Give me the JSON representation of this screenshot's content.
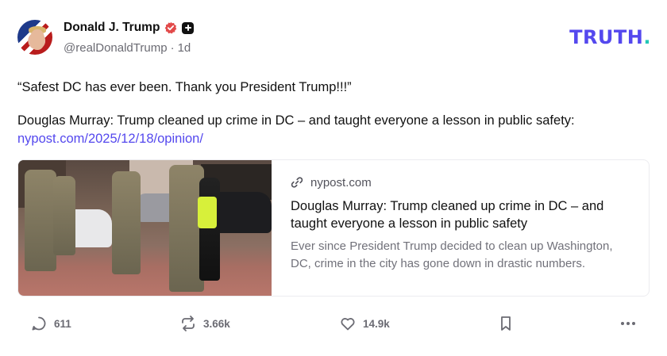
{
  "author": {
    "display_name": "Donald J. Trump",
    "handle": "@realDonaldTrump",
    "separator": "·",
    "time_ago": "1d"
  },
  "brand": {
    "logo_text": "TRUTH",
    "logo_dot": "."
  },
  "post": {
    "quote": "“Safest DC has ever been. Thank you President Trump!!!”",
    "body": "Douglas Murray: Trump cleaned up crime in DC – and taught everyone a lesson in public safety:",
    "link_text": "nypost.com/2025/12/18/opinion/"
  },
  "link_card": {
    "domain": "nypost.com",
    "title": "Douglas Murray: Trump cleaned up crime in DC – and taught everyone a lesson in public safety",
    "description": "Ever since President Trump decided to clean up Washington, DC, crime in the city has gone down in drastic numbers."
  },
  "actions": {
    "replies": "611",
    "retruths": "3.66k",
    "likes": "14.9k"
  },
  "colors": {
    "accent": "#5448ee",
    "logo_dot": "#22c7b6",
    "verified_badge": "#e24a4a"
  },
  "icons": [
    "verified-badge-icon",
    "plus-badge-icon",
    "link-icon",
    "reply-icon",
    "retruth-icon",
    "like-icon",
    "bookmark-icon",
    "more-icon"
  ]
}
